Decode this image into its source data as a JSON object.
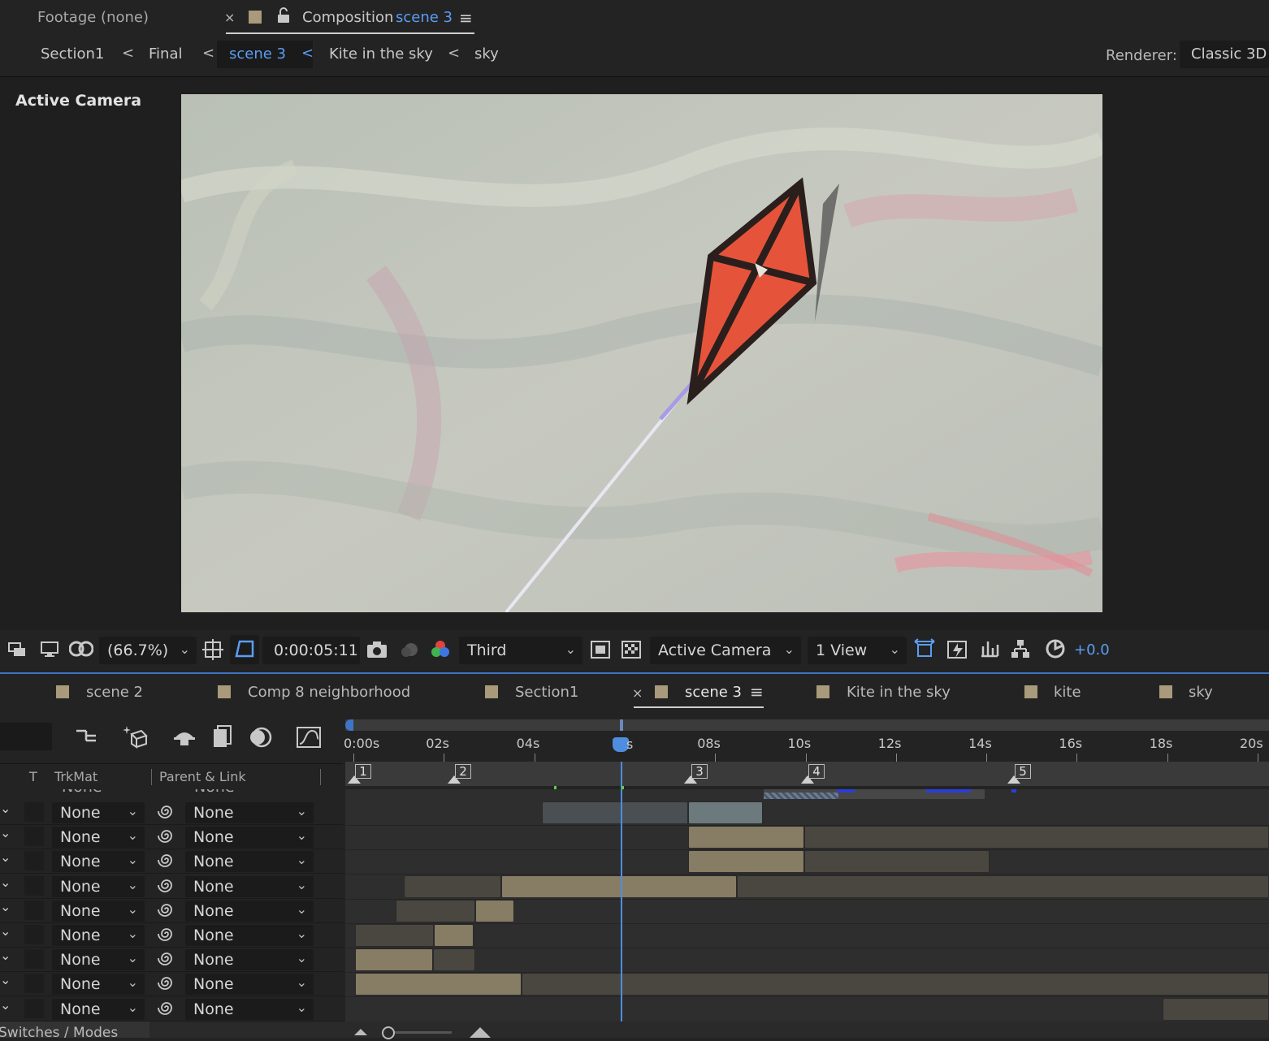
{
  "top_tabs": {
    "footage_label": "Footage (none)",
    "close": "×",
    "composition_prefix": "Composition",
    "composition_name": "scene 3",
    "menu": "≡"
  },
  "breadcrumb": {
    "items": [
      "Section1",
      "Final",
      "scene 3",
      "Kite in the sky",
      "sky"
    ],
    "separator": "<",
    "renderer_label": "Renderer:",
    "renderer_value": "Classic 3D"
  },
  "viewer": {
    "camera_label": "Active Camera"
  },
  "viewer_toolbar": {
    "zoom": "(66.7%)",
    "timecode": "0:00:05:11",
    "resolution": "Third",
    "camera": "Active Camera",
    "views": "1 View",
    "exposure": "+0.0"
  },
  "timeline_tabs": {
    "tabs": [
      "scene 2",
      "Comp 8 neighborhood",
      "Section1",
      "scene 3",
      "Kite in the sky",
      "kite",
      "sky"
    ],
    "active": "scene 3",
    "close": "×",
    "menu": "≡"
  },
  "timeline": {
    "ruler_labels": [
      "0:00s",
      "02s",
      "04s",
      "s",
      "08s",
      "10s",
      "12s",
      "14s",
      "16s",
      "18s",
      "20s"
    ],
    "markers": [
      "1",
      "2",
      "3",
      "4",
      "5"
    ],
    "current_time_seconds": 5.45,
    "col_t": "T",
    "col_trkmat": "TrkMat",
    "col_parent": "Parent & Link",
    "rows": [
      {
        "trkmat": "None",
        "parent": "None"
      },
      {
        "trkmat": "None",
        "parent": "None"
      },
      {
        "trkmat": "None",
        "parent": "None"
      },
      {
        "trkmat": "None",
        "parent": "None"
      },
      {
        "trkmat": "None",
        "parent": "None"
      },
      {
        "trkmat": "None",
        "parent": "None"
      },
      {
        "trkmat": "None",
        "parent": "None"
      },
      {
        "trkmat": "None",
        "parent": "None"
      },
      {
        "trkmat": "None",
        "parent": "None"
      }
    ],
    "switches_label": "Switches / Modes"
  },
  "colors": {
    "accent": "#5b9df2",
    "panel": "#232323",
    "layer_bar": "#877c64",
    "layer_bar_dim": "#4a4a46"
  }
}
